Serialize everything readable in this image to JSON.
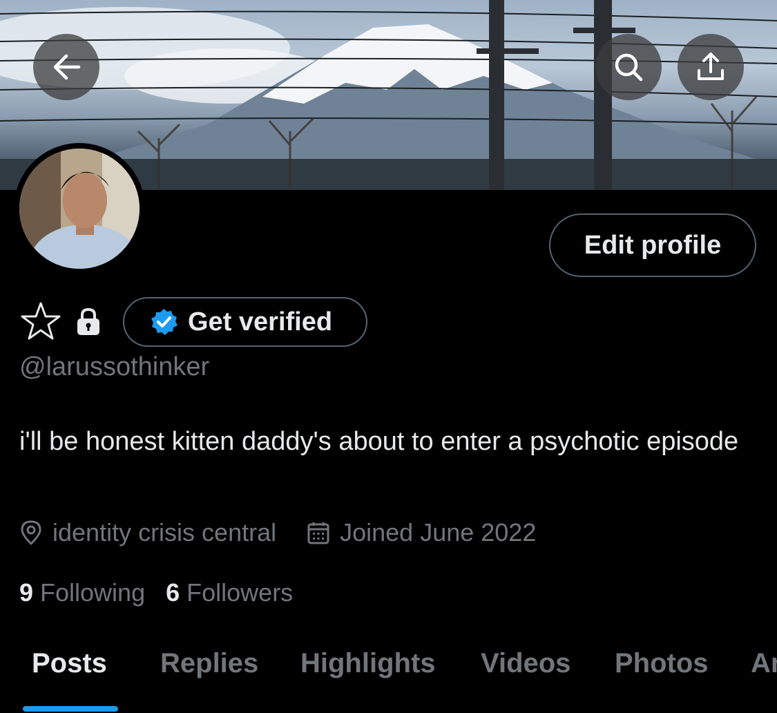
{
  "profile": {
    "handle": "@larussothinker",
    "bio": "i'll be honest kitten daddy's about to enter a psychotic episode",
    "location": "identity crisis central",
    "joined": "Joined June 2022",
    "following_count": "9",
    "following_label": "Following",
    "followers_count": "6",
    "followers_label": "Followers"
  },
  "actions": {
    "edit_profile": "Edit profile",
    "get_verified": "Get verified"
  },
  "tabs": [
    {
      "label": "Posts",
      "active": true
    },
    {
      "label": "Replies",
      "active": false
    },
    {
      "label": "Highlights",
      "active": false
    },
    {
      "label": "Videos",
      "active": false
    },
    {
      "label": "Photos",
      "active": false
    },
    {
      "label": "Ar",
      "active": false
    }
  ],
  "icons": {
    "back": "arrow-left-icon",
    "search": "search-icon",
    "share": "share-icon",
    "star": "star-icon",
    "lock": "lock-icon",
    "verified": "verified-badge-icon",
    "location": "location-pin-icon",
    "calendar": "calendar-icon"
  },
  "colors": {
    "background": "#000000",
    "primary_text": "#e7e9ea",
    "secondary_text": "#71767b",
    "border": "#536471",
    "accent": "#1d9bf0"
  }
}
